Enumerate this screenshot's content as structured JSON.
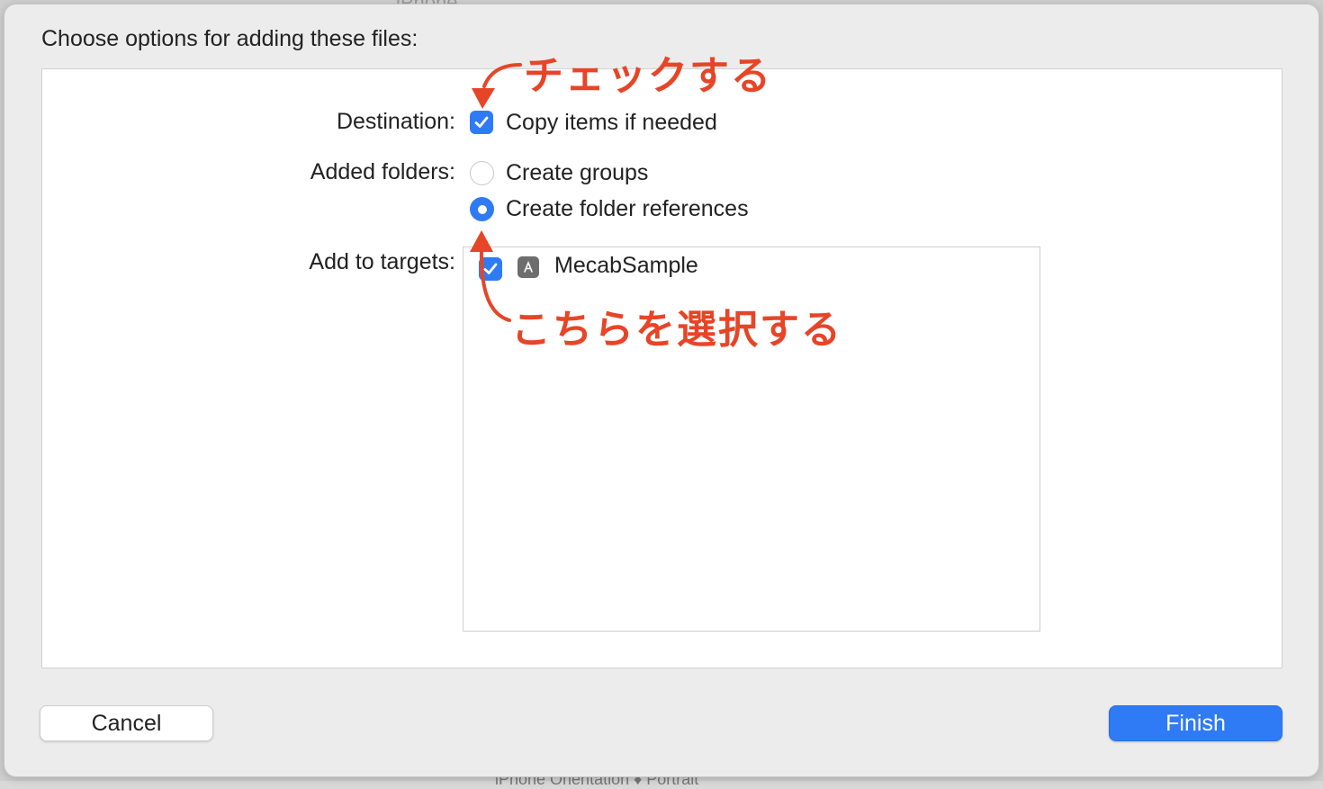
{
  "background": {
    "top_hint": "iPhone",
    "bottom_hint": "iPhone Orientation  ♦ Portrait"
  },
  "dialog": {
    "title": "Choose options for adding these files:",
    "destination": {
      "label": "Destination:",
      "checkbox_label": "Copy items if needed",
      "checked": true
    },
    "added_folders": {
      "label": "Added folders:",
      "options": [
        {
          "label": "Create groups",
          "selected": false
        },
        {
          "label": "Create folder references",
          "selected": true
        }
      ]
    },
    "add_to_targets": {
      "label": "Add to targets:",
      "targets": [
        {
          "name": "MecabSample",
          "checked": true,
          "icon": "app-target-icon"
        }
      ]
    }
  },
  "buttons": {
    "cancel": "Cancel",
    "finish": "Finish"
  },
  "annotations": {
    "check_note": "チェックする",
    "select_note": "こちらを選択する"
  },
  "colors": {
    "accent": "#2f7bf5",
    "annotation": "#e64527"
  }
}
